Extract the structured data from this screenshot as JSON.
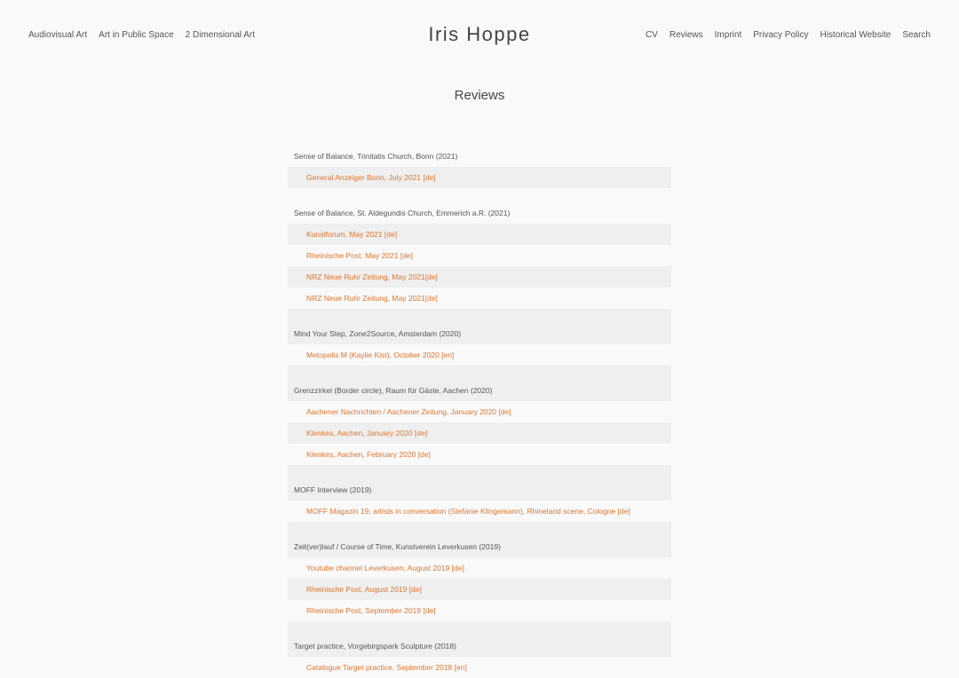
{
  "header": {
    "site_title": "Iris Hoppe",
    "nav_left": [
      "Audiovisual Art",
      "Art in Public Space",
      "2 Dimensional Art"
    ],
    "nav_right": [
      "CV",
      "Reviews",
      "Imprint",
      "Privacy Policy",
      "Historical Website",
      "Search"
    ]
  },
  "page_title": "Reviews",
  "colors": {
    "link": "#e0762f",
    "background": "#f9f9f9",
    "row_shade": "#efefef",
    "text": "#444444"
  },
  "rows": [
    {
      "type": "heading",
      "text": "Sense of Balance, Trinitatis Church, Bonn (2021)",
      "shaded": false
    },
    {
      "type": "link",
      "text": "General Anzeiger Bonn, July 2021 [de]",
      "shaded": true
    },
    {
      "type": "heading",
      "text": "Sense of Balance, St. Aldegundis Church, Emmerich a.R. (2021)",
      "shaded": false
    },
    {
      "type": "link",
      "text": "Kunstforum, May 2021 [de]",
      "shaded": true
    },
    {
      "type": "link",
      "text": "Rheinische Post, May 2021 [de]",
      "shaded": false
    },
    {
      "type": "link",
      "text": "NRZ Neue Ruhr Zeitung, May 2021[de]",
      "shaded": true
    },
    {
      "type": "link",
      "text": "NRZ Neue Ruhr Zeitung, May 2021[de]",
      "shaded": false
    },
    {
      "type": "heading",
      "text": "Mind Your Step, Zone2Source, Amsterdam (2020)",
      "shaded": true
    },
    {
      "type": "link",
      "text": "Metopolis M (Kaylie Kist), October 2020 [en]",
      "shaded": false
    },
    {
      "type": "heading",
      "text": "Grenzzirkel (Border circle), Raum für Gäste, Aachen (2020)",
      "shaded": true
    },
    {
      "type": "link",
      "text": "Aachener Nachrichten / Aachener Zeitung, January 2020 [de]",
      "shaded": false
    },
    {
      "type": "link",
      "text": "Klenkes, Aachen, January 2020 [de]",
      "shaded": true
    },
    {
      "type": "link",
      "text": "Klenkes, Aachen, February 2020 [de]",
      "shaded": false
    },
    {
      "type": "heading",
      "text": "MOFF Interview (2019)",
      "shaded": true
    },
    {
      "type": "link",
      "text": "MOFF Magazin 19, artists in conversation (Stefanie Klingemann), Rhineland scene, Cologne [de]",
      "shaded": false
    },
    {
      "type": "heading",
      "text": "Zeit(ver)lauf / Course of Time, Kunstverein Leverkusen (2019)",
      "shaded": true
    },
    {
      "type": "link",
      "text": "Youtube channel Leverkusen, August 2019 [de]",
      "shaded": false
    },
    {
      "type": "link",
      "text": "Rheinische Post, August 2019 [de]",
      "shaded": true
    },
    {
      "type": "link",
      "text": "Rheinische Post, September 2019 [de]",
      "shaded": false
    },
    {
      "type": "heading",
      "text": "Target practice, Vorgebirgspark Sculpture (2018)",
      "shaded": true
    },
    {
      "type": "link",
      "text": "Catalogue Target practice, September 2018 [en]",
      "shaded": false
    }
  ]
}
